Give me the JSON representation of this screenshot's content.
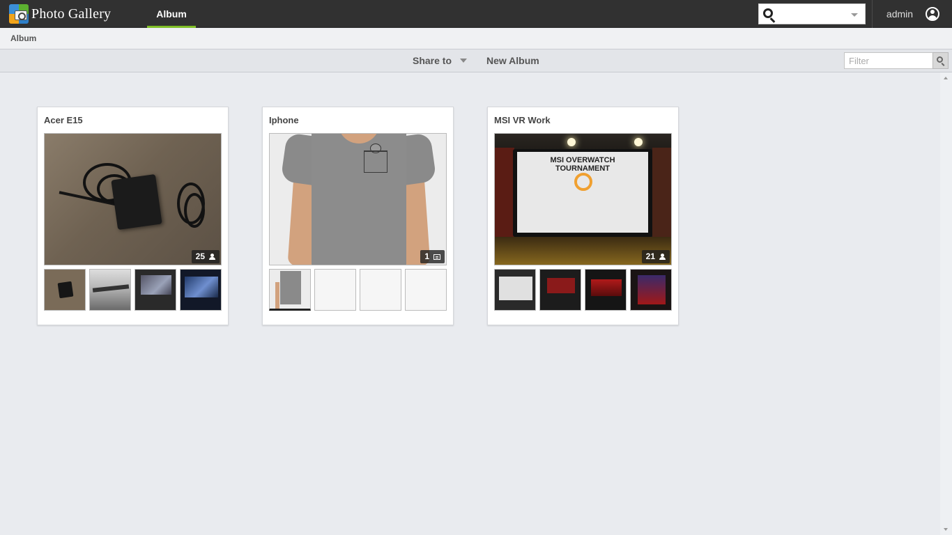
{
  "app": {
    "title": "Photo Gallery",
    "nav_tab": "Album",
    "search_placeholder": "",
    "user_name": "admin"
  },
  "breadcrumb": "Album",
  "toolbar": {
    "share_label": "Share to",
    "new_album_label": "New Album",
    "filter_placeholder": "Filter"
  },
  "albums": [
    {
      "title": "Acer E15",
      "count": "25",
      "count_icon": "person-icon",
      "thumbs": [
        "charger",
        "table",
        "laptop-game",
        "laptop-blue"
      ]
    },
    {
      "title": "Iphone",
      "count": "1",
      "count_icon": "comment-icon",
      "thumbs": [
        "t-shirt",
        "",
        "",
        ""
      ]
    },
    {
      "title": "MSI VR Work",
      "count": "21",
      "count_icon": "person-icon",
      "thumbs": [
        "event-screen",
        "event-monitor",
        "event-red",
        "event-booth"
      ]
    }
  ],
  "poster_text": "MSI OVERWATCH TOURNAMENT",
  "colors": {
    "topbar": "#313131",
    "accent": "#7fbf26",
    "page_bg": "#e9ebef"
  }
}
